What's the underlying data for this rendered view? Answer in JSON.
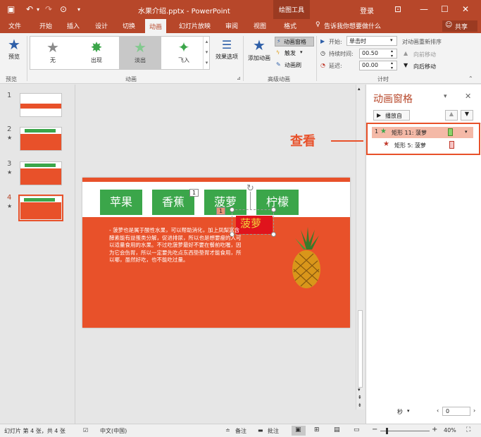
{
  "window": {
    "title": "水果介绍.pptx - PowerPoint",
    "context_tool": "绘图工具",
    "login": "登录",
    "share": "共享"
  },
  "tabs": [
    {
      "label": "文件"
    },
    {
      "label": "开始"
    },
    {
      "label": "插入"
    },
    {
      "label": "设计"
    },
    {
      "label": "切换"
    },
    {
      "label": "动画",
      "active": true
    },
    {
      "label": "幻灯片放映"
    },
    {
      "label": "审阅"
    },
    {
      "label": "视图"
    },
    {
      "label": "格式"
    }
  ],
  "tell_me": "告诉我你想要做什么",
  "ribbon": {
    "preview": "预览",
    "preview_group": "预览",
    "animation_group": "动画",
    "gallery": [
      {
        "label": "无",
        "color": "#8a8a8a"
      },
      {
        "label": "出现",
        "color": "#3ba64a"
      },
      {
        "label": "淡出",
        "color": "#3ba64a",
        "selected": true
      },
      {
        "label": "飞入",
        "color": "#3ba64a"
      }
    ],
    "effect_options": "效果选项",
    "add_animation": "添加动画",
    "anim_pane": "动画窗格",
    "trigger": "触发",
    "anim_painter": "动画刷",
    "advanced_group": "高级动画",
    "start_label": "开始:",
    "start_value": "单击时",
    "duration_label": "持续时间:",
    "duration_value": "00.50",
    "delay_label": "延迟:",
    "delay_value": "00.00",
    "reorder": "对动画重新排序",
    "move_earlier": "向前移动",
    "move_later": "向后移动",
    "timing_group": "计时"
  },
  "slides": [
    {
      "num": "1"
    },
    {
      "num": "2"
    },
    {
      "num": "3"
    },
    {
      "num": "4",
      "active": true
    }
  ],
  "slide": {
    "buttons": [
      "苹果",
      "香蕉",
      "菠萝",
      "柠檬"
    ],
    "badge1": "1",
    "badge2": "1",
    "popup": "菠萝",
    "body_text": "- 菠萝也是属于酸性水果，可以帮助消化，加上凤梨富含酵素能有益蛋类分解，促进排尿，所以也是想要瘦的人可以适量食用的水果。不过吃菠萝最好不要在餐前吃喔，因为它会伤胃，所以一定要先吃点东西垫垫胃才能食用，所以哪，虽然好吃，也不能吃过量。"
  },
  "annotation": "查看",
  "pane": {
    "title": "动画窗格",
    "play_from": "播放自",
    "items": [
      {
        "index": "1",
        "label": "矩形 11: 菠萝",
        "star_color": "#3ba64a",
        "selected": true
      },
      {
        "index": "",
        "label": "矩形 5: 菠萝",
        "star_color": "#c0392b"
      }
    ],
    "seconds": "秒",
    "zoom_value": "0"
  },
  "status": {
    "slide_info": "幻灯片 第 4 张，共 4 张",
    "language": "中文(中国)",
    "notes": "备注",
    "comments": "批注",
    "zoom": "40%"
  }
}
